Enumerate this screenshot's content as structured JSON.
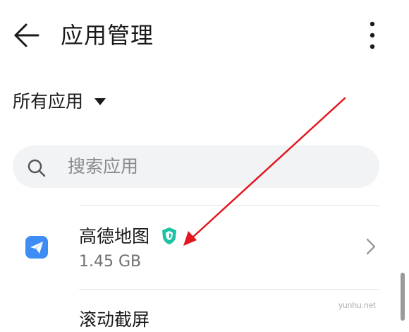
{
  "header": {
    "title": "应用管理",
    "back_icon": "arrow-left-icon",
    "more_icon": "more-vertical-icon"
  },
  "filter": {
    "label": "所有应用",
    "icon": "caret-down-icon"
  },
  "search": {
    "placeholder": "搜索应用",
    "icon": "search-icon"
  },
  "apps": [
    {
      "name": "高德地图",
      "size": "1.45 GB",
      "icon": "paper-plane-icon",
      "badge_icon": "amap-brand-icon"
    },
    {
      "name": "滚动截屏"
    }
  ],
  "watermark": "yunhu.net",
  "colors": {
    "arrow": "#e3161f",
    "app_icon_bg": "#3d8df5",
    "brand_icon": "#19c3a3",
    "search_bg": "#f1f3f5"
  }
}
